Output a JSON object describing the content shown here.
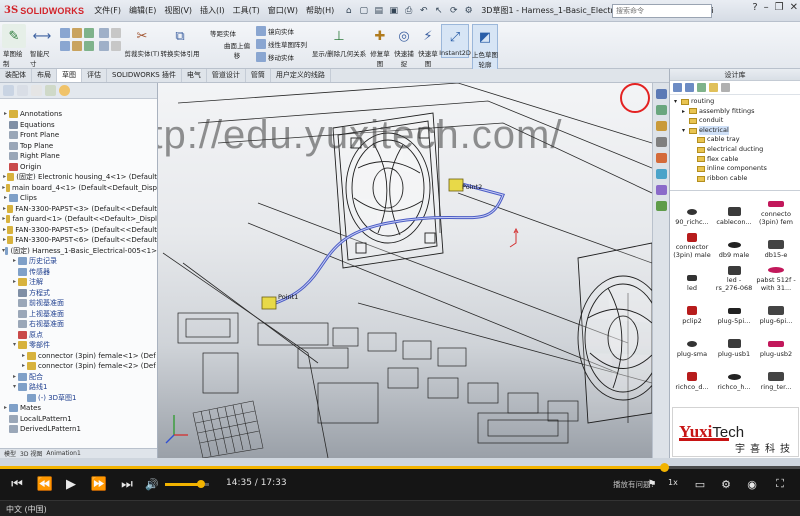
{
  "app": {
    "logo_ds": "3S",
    "logo_name": "SOLIDWORKS",
    "menu": [
      "文件(F)",
      "编辑(E)",
      "视图(V)",
      "插入(I)",
      "工具(T)",
      "窗口(W)",
      "帮助(H)"
    ],
    "doc_title": "3D草图1 - Harness_1-Basic_Electrical-005 <-- Basic_Electrical.SLDA...",
    "search_placeholder": "搜索命令"
  },
  "ribbon": {
    "sketch_label": "草图绘制",
    "smart_dim_label": "智能尺寸",
    "trim_label": "剪裁实体(T)",
    "convert_label": "转换实体引用",
    "offset_label": "等距实体",
    "surface_label": "曲面上偏移",
    "mirror_label": "镜向实体",
    "linear_label": "线性草图阵列",
    "move_label": "移动实体",
    "show_relations_label": "显示/删除几何关系",
    "repair_label": "修复草图",
    "quick_snap_label": "快速捕捉",
    "quick_sketch_label": "快速草图",
    "instant2d_label": "Instant2D",
    "shade_label": "上色草图轮廓"
  },
  "command_tabs": [
    "装配体",
    "布局",
    "草图",
    "评估",
    "SOLIDWORKS 插件",
    "电气",
    "管道设计",
    "管筒",
    "用户定义的线路"
  ],
  "active_tab": 2,
  "feature_tree": {
    "items": [
      {
        "label": "Annotations",
        "indent": 0,
        "exp": "▸",
        "color": "#d7b23d"
      },
      {
        "label": "Equations",
        "indent": 0,
        "exp": "",
        "color": "#7f8fa5"
      },
      {
        "label": "Front Plane",
        "indent": 0,
        "exp": "",
        "color": "#9aa7b8"
      },
      {
        "label": "Top Plane",
        "indent": 0,
        "exp": "",
        "color": "#9aa7b8"
      },
      {
        "label": "Right Plane",
        "indent": 0,
        "exp": "",
        "color": "#9aa7b8"
      },
      {
        "label": "Origin",
        "indent": 0,
        "exp": "",
        "color": "#c94a4a"
      },
      {
        "label": "(固定) Electronic housing_4<1> (Default",
        "indent": 0,
        "exp": "▸",
        "color": "#d7b23d"
      },
      {
        "label": "main board_4<1> (Default<Default_Disp",
        "indent": 0,
        "exp": "▸",
        "color": "#d7b23d"
      },
      {
        "label": "Clips",
        "indent": 0,
        "exp": "▸",
        "color": "#7fa0c8"
      },
      {
        "label": "FAN-3300-PAPST<3> (Default<<Default",
        "indent": 0,
        "exp": "▸",
        "color": "#d7b23d"
      },
      {
        "label": "fan guard<1> (Default<<Default>_Displ",
        "indent": 0,
        "exp": "▸",
        "color": "#d7b23d"
      },
      {
        "label": "FAN-3300-PAPST<5> (Default<<Default",
        "indent": 0,
        "exp": "▸",
        "color": "#d7b23d"
      },
      {
        "label": "FAN-3300-PAPST<6> (Default<<Default",
        "indent": 0,
        "exp": "▸",
        "color": "#d7b23d"
      },
      {
        "label": "(固定) Harness_1-Basic_Electrical-005<1>",
        "indent": 0,
        "exp": "▾",
        "color": "#7fa0c8"
      },
      {
        "label": "历史记录",
        "indent": 1,
        "exp": "▸",
        "color": "#7fa0c8",
        "sub": true
      },
      {
        "label": "传感器",
        "indent": 1,
        "exp": "",
        "color": "#7fa0c8",
        "sub": true
      },
      {
        "label": "注解",
        "indent": 1,
        "exp": "▸",
        "color": "#d7b23d",
        "sub": true
      },
      {
        "label": "方程式",
        "indent": 1,
        "exp": "",
        "color": "#7f8fa5",
        "sub": true
      },
      {
        "label": "前视基准面",
        "indent": 1,
        "exp": "",
        "color": "#9aa7b8",
        "sub": true
      },
      {
        "label": "上视基准面",
        "indent": 1,
        "exp": "",
        "color": "#9aa7b8",
        "sub": true
      },
      {
        "label": "右视基准面",
        "indent": 1,
        "exp": "",
        "color": "#9aa7b8",
        "sub": true
      },
      {
        "label": "原点",
        "indent": 1,
        "exp": "",
        "color": "#c94a4a",
        "sub": true
      },
      {
        "label": "零部件",
        "indent": 1,
        "exp": "▾",
        "color": "#d7b23d",
        "sub": true
      },
      {
        "label": "connector (3pin) female<1> (Def",
        "indent": 2,
        "exp": "▸",
        "color": "#d7b23d"
      },
      {
        "label": "connector (3pin) female<2> (Def",
        "indent": 2,
        "exp": "▸",
        "color": "#d7b23d"
      },
      {
        "label": "配合",
        "indent": 1,
        "exp": "▸",
        "color": "#7fa0c8",
        "sub": true
      },
      {
        "label": "路线1",
        "indent": 1,
        "exp": "▾",
        "color": "#7fa0c8",
        "sub": true
      },
      {
        "label": "(-) 3D草图1",
        "indent": 2,
        "exp": "",
        "color": "#7fa0c8",
        "sub": true
      },
      {
        "label": "Mates",
        "indent": 0,
        "exp": "▸",
        "color": "#7fa0c8"
      },
      {
        "label": "LocalLPattern1",
        "indent": 0,
        "exp": "",
        "color": "#9aa7b8"
      },
      {
        "label": "DerivedLPattern1",
        "indent": 0,
        "exp": "",
        "color": "#9aa7b8"
      }
    ],
    "bottom_tabs": [
      "模型",
      "3D 视图",
      "Animation1"
    ]
  },
  "viewport": {
    "watermark": "http://edu.yuxitech.com/",
    "point1_label": "Point1",
    "point2_label": "Point2"
  },
  "design_library": {
    "title": "设计库",
    "tree": [
      {
        "label": "routing",
        "indent": 0,
        "exp": "▾"
      },
      {
        "label": "assembly fittings",
        "indent": 1,
        "exp": "▸"
      },
      {
        "label": "conduit",
        "indent": 1,
        "exp": ""
      },
      {
        "label": "electrical",
        "indent": 1,
        "exp": "▾",
        "sel": true
      },
      {
        "label": "cable tray",
        "indent": 2,
        "exp": ""
      },
      {
        "label": "electrical ducting",
        "indent": 2,
        "exp": ""
      },
      {
        "label": "flex cable",
        "indent": 2,
        "exp": ""
      },
      {
        "label": "inline components",
        "indent": 2,
        "exp": ""
      },
      {
        "label": "ribbon cable",
        "indent": 2,
        "exp": ""
      }
    ],
    "items": [
      "90_richc...",
      "cablecon...",
      "connecto (3pin) fem",
      "connector (3pin) male",
      "db9 male",
      "db15-e",
      "led",
      "led - rs_276-068",
      "pabst 512f - with 31...",
      "pclip2",
      "plug-5pi...",
      "plug-6pi...",
      "plug-sma",
      "plug-usb1",
      "plug-usb2",
      "richco_d...",
      "richco_h...",
      "ring_ter..."
    ]
  },
  "promo": {
    "y": "Yuxi",
    "tech": "Tech",
    "cn": "宇喜科技"
  },
  "player": {
    "current_time": "14:35",
    "total_time": "17:33",
    "time_display": "14:35 / 17:33",
    "progress": 0.83,
    "volume": 0.82,
    "report_label": "播放有问题?",
    "speed_label": "1x",
    "language_label": "中文 (中国)",
    "accent": "#f2b300"
  }
}
